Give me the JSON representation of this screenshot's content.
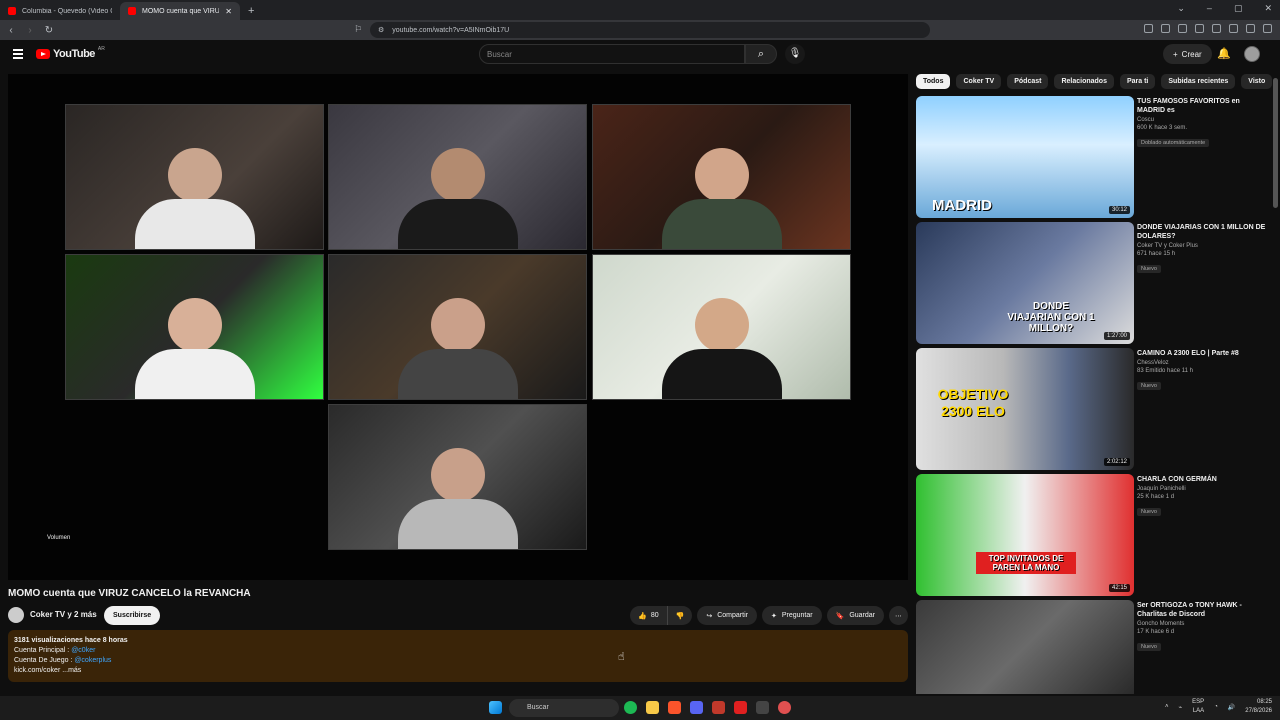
{
  "browser": {
    "tabs": [
      {
        "label": "Columbia - Quevedo (Video Oficial)",
        "active": false
      },
      {
        "label": "MOMO cuenta que VIRUZ CA",
        "active": true
      }
    ],
    "url": "youtube.com/watch?v=A5INmOib17U"
  },
  "header": {
    "logo_text": "YouTube",
    "region": "AR",
    "search_placeholder": "Buscar",
    "create_label": "Crear"
  },
  "player": {
    "volume_label": "Volumen"
  },
  "video": {
    "title": "MOMO cuenta que VIRUZ CANCELO la REVANCHA",
    "channel": "Coker TV y 2 más",
    "subscribe_label": "Suscribirse",
    "likes": "80",
    "share_label": "Compartir",
    "ask_label": "Preguntar",
    "save_label": "Guardar"
  },
  "description": {
    "meta": "3181 visualizaciones  hace 8 horas",
    "line1_label": "Cuenta Principal : ",
    "line1_link": "@c0ker",
    "line2_label": "Cuenta De Juego : ",
    "line2_link": "@cokerplus",
    "line3": "kick.com/coker ...más"
  },
  "chips": [
    "Todos",
    "Coker TV",
    "Pódcast",
    "Relacionados",
    "Para ti",
    "Subidas recientes",
    "Visto"
  ],
  "recommendations": [
    {
      "title": "TUS FAMOSOS FAVORITOS en MADRID es",
      "channel": "Coscu",
      "meta": "600 K  hace 3 sem.",
      "badge": "Doblado automáticamente",
      "duration": "30:12",
      "overlay": "MADRID"
    },
    {
      "title": "DONDE VIAJARIAS CON 1 MILLON DE DOLARES?",
      "channel": "Coker TV y Coker Plus",
      "meta": "671  hace 15 h",
      "badge": "Nuevo",
      "duration": "1:27:00",
      "overlay": "DONDE VIAJARIAN CON 1 MILLON?"
    },
    {
      "title": "CAMINO A 2300 ELO | Parte #8",
      "channel": "ChessVeloz",
      "meta": "83  Emitido hace 11 h",
      "badge": "Nuevo",
      "duration": "2:02:12",
      "overlay": "OBJETIVO 2300 ELO"
    },
    {
      "title": "CHARLA CON GERMÁN",
      "channel": "Joaquín Panichelli",
      "meta": "25 K  hace 1 d",
      "badge": "Nuevo",
      "duration": "42:15",
      "overlay": "TOP INVITADOS DE PAREN LA MANO"
    },
    {
      "title": "Ser ORTIGOZA o TONY HAWK - Charlitas de Discord",
      "channel": "Goncho Moments",
      "meta": "17 K  hace 6 d",
      "badge": "Nuevo",
      "duration": "",
      "overlay": ""
    }
  ],
  "taskbar": {
    "search_placeholder": "Buscar",
    "lang": "ESP",
    "lang2": "LAA",
    "time": "08:25",
    "date": "27/8/2026"
  },
  "colors": {
    "accent": "#ff0000",
    "link": "#3ea6ff",
    "description_bg": "#3a2408"
  }
}
